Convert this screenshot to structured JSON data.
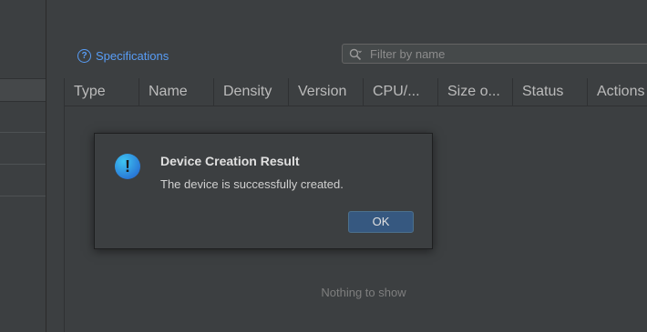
{
  "toolbar": {
    "specifications_label": "Specifications",
    "help_icon_glyph": "?",
    "filter_placeholder": "Filter by name",
    "filter_value": ""
  },
  "table": {
    "columns": [
      "Type",
      "Name",
      "Density",
      "Version",
      "CPU/...",
      "Size o...",
      "Status",
      "Actions"
    ],
    "empty_text": "Nothing to show"
  },
  "dialog": {
    "title": "Device Creation Result",
    "message": "The device is successfully created.",
    "ok_label": "OK",
    "icon_glyph": "!"
  },
  "colors": {
    "background": "#3c3f41",
    "link": "#589df6",
    "button": "#365880"
  }
}
